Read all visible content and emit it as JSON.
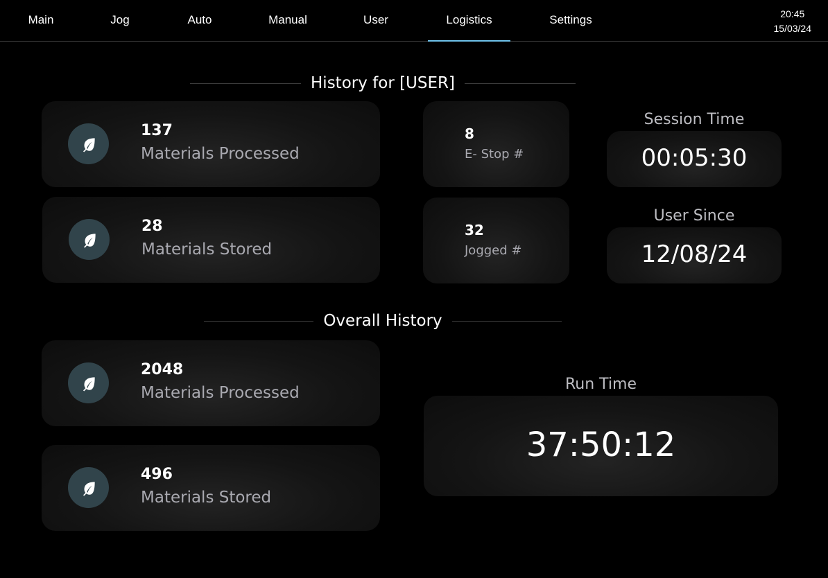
{
  "nav": {
    "tabs": [
      {
        "label": "Main"
      },
      {
        "label": "Jog"
      },
      {
        "label": "Auto"
      },
      {
        "label": "Manual"
      },
      {
        "label": "User"
      },
      {
        "label": "Logistics",
        "active": true
      },
      {
        "label": "Settings"
      }
    ],
    "clock": {
      "time": "20:45",
      "date": "15/03/24"
    },
    "accent_color": "#6fc3ec"
  },
  "user_history": {
    "title": "History for [USER]",
    "materials_processed": {
      "value": "137",
      "label": "Materials Processed",
      "icon": "leaf-icon"
    },
    "materials_stored": {
      "value": "28",
      "label": "Materials Stored",
      "icon": "leaf-icon"
    },
    "estop": {
      "value": "8",
      "label": "E- Stop #"
    },
    "jogged": {
      "value": "32",
      "label": "Jogged #"
    },
    "session_time": {
      "label": "Session Time",
      "value": "00:05:30"
    },
    "user_since": {
      "label": "User Since",
      "value": "12/08/24"
    }
  },
  "overall_history": {
    "title": "Overall History",
    "materials_processed": {
      "value": "2048",
      "label": "Materials Processed",
      "icon": "leaf-icon"
    },
    "materials_stored": {
      "value": "496",
      "label": "Materials Stored",
      "icon": "leaf-icon"
    },
    "run_time": {
      "label": "Run Time",
      "value": "37:50:12"
    }
  },
  "colors": {
    "badge": "#31444b",
    "background": "#000000"
  }
}
